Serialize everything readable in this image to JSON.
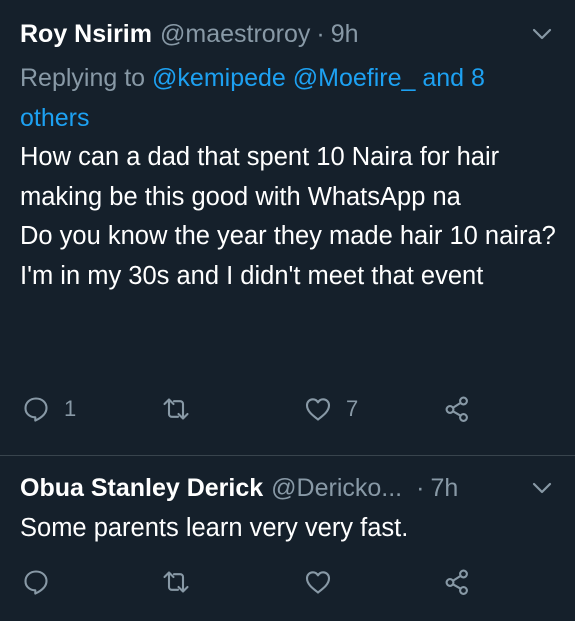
{
  "tweets": [
    {
      "name": "Roy Nsirim",
      "handle": "@maestroroy",
      "separator": "·",
      "time": "9h",
      "replying_prefix": "Replying to",
      "replying_mentions": "@kemipede @Moefire_ and 8 others",
      "text_lines": [
        "How can a dad that spent 10 Naira for hair making be this good with WhatsApp na",
        "Do you know the year they made hair 10 naira? I'm in my 30s and I didn't meet that event"
      ],
      "reply_count": "1",
      "retweet_count": "",
      "like_count": "7"
    },
    {
      "name": "Obua Stanley Derick",
      "handle": "@Dericko...",
      "separator": "·",
      "time": "7h",
      "text_lines": [
        "Some parents learn very very fast."
      ],
      "reply_count": "",
      "retweet_count": "",
      "like_count": ""
    }
  ],
  "icons": {
    "reply": "reply-icon",
    "retweet": "retweet-icon",
    "like": "heart-icon",
    "share": "share-icon",
    "menu": "chevron-down-icon"
  },
  "colors": {
    "background": "#15202b",
    "text": "#ffffff",
    "secondary": "#8899a6",
    "link": "#1da1f2",
    "divider": "#38444d"
  }
}
